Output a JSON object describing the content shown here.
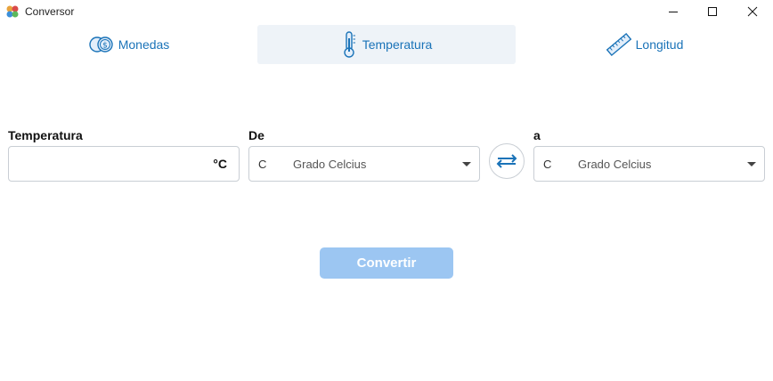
{
  "window": {
    "title": "Conversor",
    "icon": "app-icon",
    "controls": [
      "minimize-icon",
      "maximize-icon",
      "close-icon"
    ]
  },
  "tabs": [
    {
      "label": "Monedas",
      "icon": "coins-icon",
      "selected": false
    },
    {
      "label": "Temperatura",
      "icon": "thermometer-icon",
      "selected": true
    },
    {
      "label": "Longitud",
      "icon": "ruler-icon",
      "selected": false
    }
  ],
  "form": {
    "temperature": {
      "label": "Temperatura",
      "value": "",
      "unit": "°C"
    },
    "from": {
      "label": "De",
      "code": "C",
      "name": "Grado Celcius"
    },
    "to": {
      "label": "a",
      "code": "C",
      "name": "Grado Celcius"
    },
    "swap_icon": "swap-arrows-icon"
  },
  "convert": {
    "label": "Convertir",
    "enabled": false
  },
  "colors": {
    "accent": "#1a73b8",
    "tab_selected_bg": "#eef3f8",
    "button_disabled": "#9cc6f2",
    "border": "#c9ced4"
  }
}
